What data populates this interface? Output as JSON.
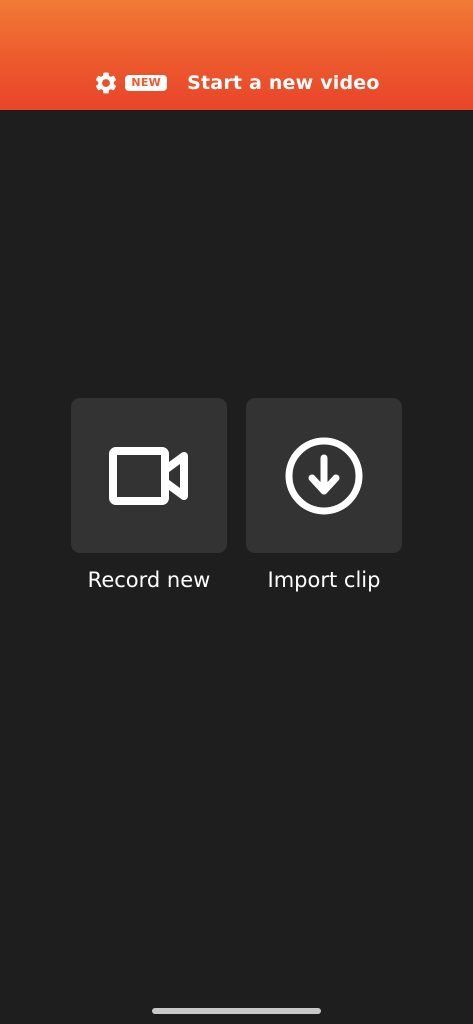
{
  "header": {
    "badge": "NEW",
    "title": "Start a new video",
    "settings_icon": "gear-icon",
    "gradient_top": "#f07a35",
    "gradient_bottom": "#e9452a"
  },
  "actions": {
    "record": {
      "label": "Record new",
      "icon": "video-camera-icon"
    },
    "import": {
      "label": "Import clip",
      "icon": "download-circle-icon"
    }
  },
  "colors": {
    "background": "#1e1e1f",
    "tile": "#333334",
    "text": "#ffffff"
  }
}
